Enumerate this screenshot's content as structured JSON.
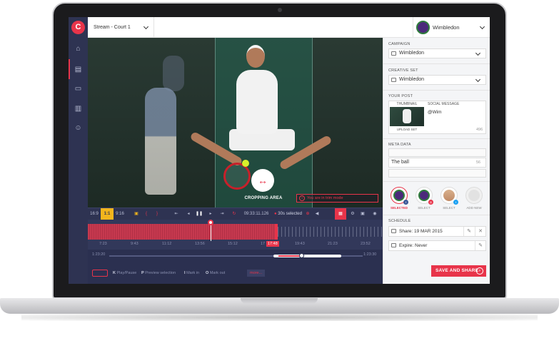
{
  "topbar": {
    "logo_letter": "C",
    "stream_label": "Stream - Court 1",
    "brand_label": "Wimbledon"
  },
  "video": {
    "crop_label": "CROPPING AREA",
    "crop_icon": "↔",
    "message": "You are in trim mode"
  },
  "controls": {
    "ratio_16_9": "16:9",
    "ratio_1_1": "1:1",
    "ratio_9_16": "9:16",
    "time": "09:33:11.126",
    "selected": "30s selected"
  },
  "timeline": {
    "ticks": [
      "7:23",
      "9:43",
      "11:12",
      "13:56",
      "15:12",
      "17",
      "19:43",
      "21:23",
      "23:52"
    ],
    "current": "17:48"
  },
  "scrub": {
    "start": "1:23:20",
    "end": "1:23:30"
  },
  "shortcuts": {
    "play": {
      "key": "K",
      "label": "Play/Pause"
    },
    "preview": {
      "key": "P",
      "label": "Preview selection"
    },
    "mark_in": {
      "key": "I",
      "label": "Mark in"
    },
    "mark_out": {
      "key": "O",
      "label": "Mark out"
    },
    "more": "more..."
  },
  "panel": {
    "campaign_title": "CAMPAIGN",
    "campaign_value": "Wimbledon",
    "creative_title": "CREATIVE SET",
    "creative_value": "Wimbledon",
    "post_title": "YOUR POST",
    "thumbnail_label": "THUMBNAIL",
    "thumb_upload": "UPLOAD",
    "thumb_set": "SET",
    "social_label": "SOCIAL MESSAGE",
    "social_text": "@Wim",
    "social_count": "496",
    "meta_title": "META DATA",
    "meta_title_value": "The ball",
    "meta_count": "56",
    "avatars": [
      {
        "caption": "SELECTED"
      },
      {
        "caption": "SELECT"
      },
      {
        "caption": "SELECT"
      },
      {
        "caption": "ADD NEW"
      }
    ],
    "schedule_title": "SCHEDULE",
    "share": "Share: 19 MAR 2015",
    "expire": "Expire: Never",
    "save_label": "SAVE AND SHARE"
  },
  "colors": {
    "accent": "#e8344a",
    "nav": "#2e3352",
    "highlight": "#f3b51d"
  }
}
